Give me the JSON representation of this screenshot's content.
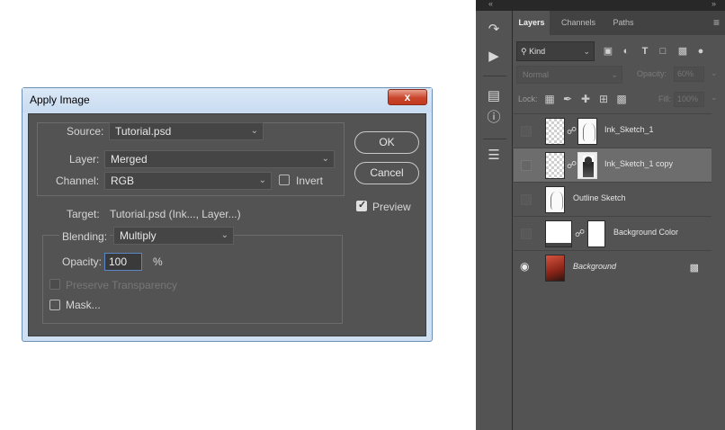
{
  "dialog": {
    "title": "Apply Image",
    "close_glyph": "x",
    "source_label": "Source:",
    "source_value": "Tutorial.psd",
    "layer_label": "Layer:",
    "layer_value": "Merged",
    "channel_label": "Channel:",
    "channel_value": "RGB",
    "invert_label": "Invert",
    "invert_checked": false,
    "target_label": "Target:",
    "target_value": "Tutorial.psd (Ink..., Layer...)",
    "blending_label": "Blending:",
    "blending_value": "Multiply",
    "opacity_label": "Opacity:",
    "opacity_value": "100",
    "opacity_unit": "%",
    "preserve_label": "Preserve Transparency",
    "preserve_checked": false,
    "mask_label": "Mask...",
    "mask_checked": false,
    "ok_label": "OK",
    "cancel_label": "Cancel",
    "preview_label": "Preview",
    "preview_checked": true
  },
  "ps": {
    "tabs": [
      {
        "label": "Layers",
        "active": true
      },
      {
        "label": "Channels",
        "active": false
      },
      {
        "label": "Paths",
        "active": false
      }
    ],
    "filter_kind": "Kind",
    "blend_mode": "Normal",
    "opacity_label": "Opacity:",
    "opacity_value": "60%",
    "lock_label": "Lock:",
    "fill_label": "Fill:",
    "fill_value": "100%",
    "layers": [
      {
        "name": "Ink_Sketch_1",
        "visible": false,
        "selected": false,
        "italic": false
      },
      {
        "name": "Ink_Sketch_1 copy",
        "visible": false,
        "selected": true,
        "italic": false
      },
      {
        "name": "Outline Sketch",
        "visible": false,
        "selected": false,
        "italic": false
      },
      {
        "name": "Background Color",
        "visible": false,
        "selected": false,
        "italic": false
      },
      {
        "name": "Background",
        "visible": true,
        "selected": false,
        "italic": true,
        "locked": true
      }
    ]
  },
  "colors": {
    "dialog_frame": "#cfe0f3",
    "dialog_body": "#535353",
    "ps_panel": "#535353",
    "ps_selected_layer": "#6d6d6d",
    "close_button": "#c9452b"
  }
}
